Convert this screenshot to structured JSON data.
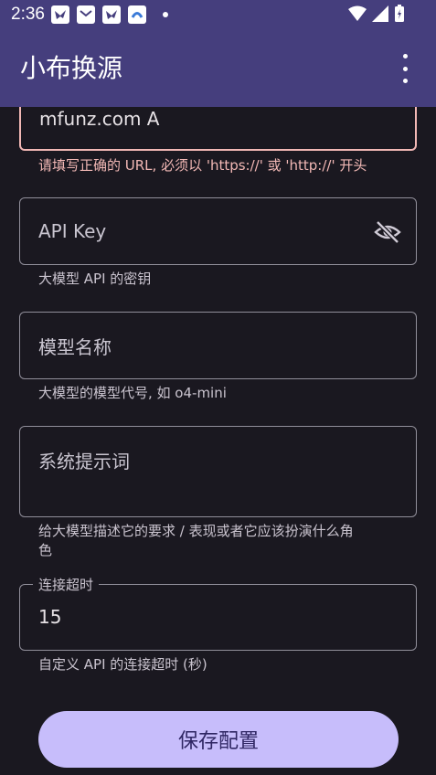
{
  "status_bar": {
    "time": "2:36"
  },
  "app_bar": {
    "title": "小布换源"
  },
  "form": {
    "url_field": {
      "value": "mfunz.com A",
      "error": "请填写正确的 URL, 必须以 'https://' 或 'http://' 开头"
    },
    "api_key_field": {
      "placeholder": "API Key",
      "helper": "大模型 API 的密钥"
    },
    "model_field": {
      "placeholder": "模型名称",
      "helper": "大模型的模型代号, 如 o4-mini"
    },
    "system_prompt_field": {
      "placeholder": "系统提示词",
      "helper_line1": "给大模型描述它的要求 / 表现或者它应该扮演什么角",
      "helper_line2": "色"
    },
    "timeout_field": {
      "label": "连接超时",
      "value": "15",
      "helper": "自定义 API 的连接超时 (秒)"
    },
    "save_button": {
      "label": "保存配置"
    }
  },
  "colors": {
    "app_bar": "#453e7d",
    "background": "#1a1820",
    "error": "#f2b8b5",
    "button": "#c7bdfb"
  }
}
